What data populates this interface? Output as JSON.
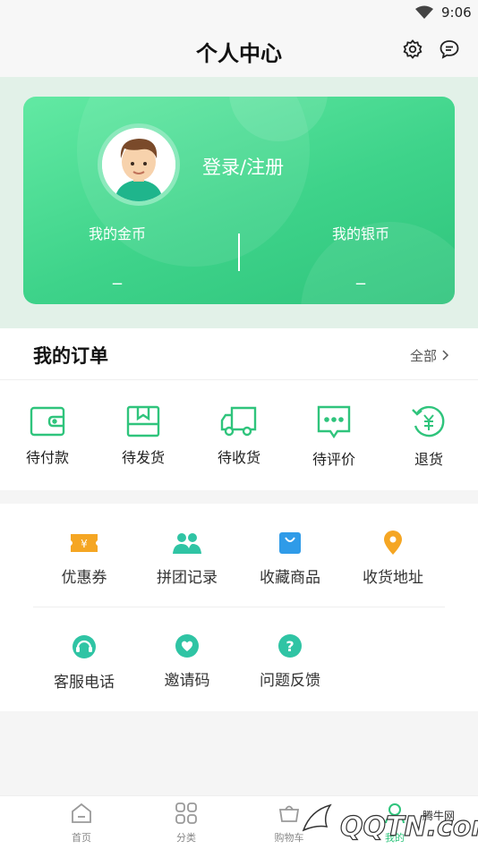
{
  "status": {
    "time": "9:06"
  },
  "header": {
    "title": "个人中心"
  },
  "profile": {
    "login_text": "登录/注册",
    "gold_label": "我的金币",
    "gold_value": "_",
    "silver_label": "我的银币",
    "silver_value": "_"
  },
  "orders": {
    "title": "我的订单",
    "all_label": "全部",
    "items": [
      {
        "label": "待付款",
        "icon": "wallet-icon"
      },
      {
        "label": "待发货",
        "icon": "package-icon"
      },
      {
        "label": "待收货",
        "icon": "truck-icon"
      },
      {
        "label": "待评价",
        "icon": "comment-icon"
      },
      {
        "label": "退货",
        "icon": "refund-icon"
      }
    ]
  },
  "tools": {
    "items": [
      {
        "label": "优惠券",
        "icon": "coupon-icon"
      },
      {
        "label": "拼团记录",
        "icon": "group-icon"
      },
      {
        "label": "收藏商品",
        "icon": "bag-icon"
      },
      {
        "label": "收货地址",
        "icon": "location-icon"
      },
      {
        "label": "客服电话",
        "icon": "headset-icon"
      },
      {
        "label": "邀请码",
        "icon": "heart-icon"
      },
      {
        "label": "问题反馈",
        "icon": "question-icon"
      }
    ]
  },
  "tabbar": {
    "items": [
      {
        "label": "首页",
        "icon": "home-icon"
      },
      {
        "label": "分类",
        "icon": "grid-icon"
      },
      {
        "label": "购物车",
        "icon": "cart-icon"
      },
      {
        "label": "我的",
        "icon": "user-icon"
      }
    ]
  },
  "watermark": {
    "text1": "腾牛网",
    "text2": "QQTN.com"
  },
  "colors": {
    "accent": "#3ed38a",
    "coupon": "#f5a623",
    "location": "#f5a623",
    "bag": "#2f9be8"
  }
}
